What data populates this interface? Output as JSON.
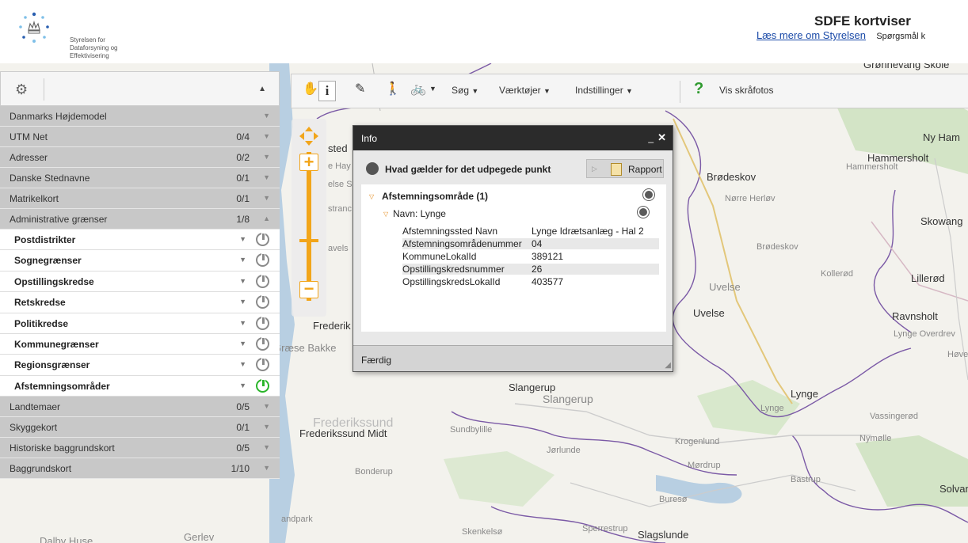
{
  "header": {
    "logo_lines": [
      "Styrelsen for",
      "Dataforsyning og",
      "Effektivisering"
    ],
    "title": "SDFE kortviser",
    "read_more": "Læs mere om Styrelsen",
    "help": "Spørgsmål k"
  },
  "toolbar": {
    "search": "Søg",
    "tools": "Værktøjer",
    "settings": "Indstillinger",
    "oblique": "Vis skråfotos"
  },
  "layers": [
    {
      "name": "Danmarks Højdemodel",
      "count": "",
      "type": "group"
    },
    {
      "name": "UTM Net",
      "count": "0/4",
      "type": "group"
    },
    {
      "name": "Adresser",
      "count": "0/2",
      "type": "group"
    },
    {
      "name": "Danske Stednavne",
      "count": "0/1",
      "type": "group"
    },
    {
      "name": "Matrikelkort",
      "count": "0/1",
      "type": "group"
    },
    {
      "name": "Administrative grænser",
      "count": "1/8",
      "type": "group",
      "expanded": true
    },
    {
      "name": "Postdistrikter",
      "type": "sub",
      "on": false
    },
    {
      "name": "Sognegrænser",
      "type": "sub",
      "on": false
    },
    {
      "name": "Opstillingskredse",
      "type": "sub",
      "on": false
    },
    {
      "name": "Retskredse",
      "type": "sub",
      "on": false
    },
    {
      "name": "Politikredse",
      "type": "sub",
      "on": false
    },
    {
      "name": "Kommunegrænser",
      "type": "sub",
      "on": false
    },
    {
      "name": "Regionsgrænser",
      "type": "sub",
      "on": false
    },
    {
      "name": "Afstemningsområder",
      "type": "sub",
      "on": true
    },
    {
      "name": "Landtemaer",
      "count": "0/5",
      "type": "group"
    },
    {
      "name": "Skyggekort",
      "count": "0/1",
      "type": "group"
    },
    {
      "name": "Historiske baggrundskort",
      "count": "0/5",
      "type": "group"
    },
    {
      "name": "Baggrundskort",
      "count": "1/10",
      "type": "group"
    }
  ],
  "info": {
    "title": "Info",
    "query": "Hvad gælder for det udpegede punkt",
    "report": "Rapport",
    "result_title": "Afstemningsområde (1)",
    "result_sub": "Navn: Lynge",
    "attributes": [
      {
        "key": "Afstemningssted Navn",
        "value": "Lynge Idrætsanlæg - Hal 2"
      },
      {
        "key": "Afstemningsområdenummer",
        "value": "04"
      },
      {
        "key": "KommuneLokalId",
        "value": "389121"
      },
      {
        "key": "Opstillingskredsnummer",
        "value": "26"
      },
      {
        "key": "OpstillingskredsLokalId",
        "value": "403577"
      }
    ],
    "done": "Færdig"
  },
  "map_labels": [
    "Grønnevang Skole",
    "Ny Ham",
    "Hammersholt",
    "Hammersholt",
    "Brødeskov",
    "Nørre Herløv",
    "Brødeskov",
    "Skowang",
    "Kollerød",
    "Lillerød",
    "Uvelse",
    "Uvelse",
    "Ravnsholt",
    "Lynge Overdrev",
    "Høve",
    "Lynge",
    "Lynge",
    "Vassingerød",
    "Nymølle",
    "Slangerup",
    "Slangerup",
    "Frederikssund Midt",
    "Frederikssund",
    "Sundbylille",
    "Jørlunde",
    "Krogenlund",
    "Mørdrup",
    "Bastrup",
    "Buresø",
    "Solvan",
    "Bonderup",
    "Skenkelsø",
    "Sperrestrup",
    "Slagslunde",
    "Dalby Huse",
    "Gerlev",
    "andpark",
    "Frederik",
    "Græse Bakke",
    "sted",
    "e Hay",
    "else S",
    "stranc",
    "avels"
  ]
}
